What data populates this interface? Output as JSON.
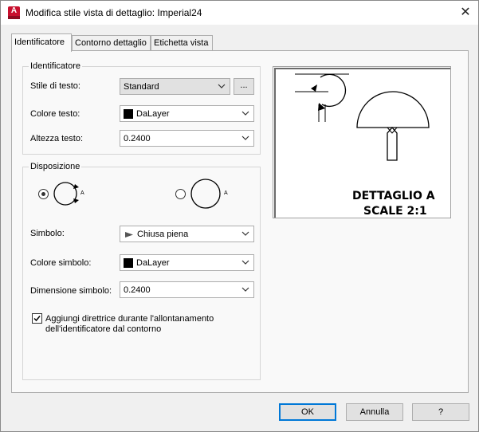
{
  "window": {
    "title": "Modifica stile vista di dettaglio: Imperial24",
    "app_icon_letter": "A",
    "close_glyph": "✕"
  },
  "tabs": [
    {
      "label": "Identificatore",
      "active": true
    },
    {
      "label": "Contorno dettaglio",
      "active": false
    },
    {
      "label": "Etichetta vista",
      "active": false
    }
  ],
  "identifier_group": {
    "title": "Identificatore",
    "text_style": {
      "label": "Stile di testo:",
      "value": "Standard",
      "browse_label": "..."
    },
    "text_color": {
      "label": "Colore testo:",
      "value": "DaLayer",
      "swatch_color": "#000000"
    },
    "text_height": {
      "label": "Altezza testo:",
      "value": "0.2400"
    }
  },
  "layout_group": {
    "title": "Disposizione",
    "option_a_letter": "A",
    "option_b_letter": "A",
    "symbol": {
      "label": "Simbolo:",
      "value": "Chiusa piena"
    },
    "symbol_color": {
      "label": "Colore simbolo:",
      "value": "DaLayer",
      "swatch_color": "#000000"
    },
    "symbol_size": {
      "label": "Dimensione simbolo:",
      "value": "0.2400"
    },
    "leader_checkbox": {
      "checked": true,
      "line1": "Aggiungi direttrice durante l'allontanamento",
      "line2": "dell'identificatore dal contorno"
    }
  },
  "preview": {
    "line1": "DETTAGLIO A",
    "line2": "SCALE 2:1"
  },
  "buttons": {
    "ok": "OK",
    "cancel": "Annulla",
    "help": "?"
  },
  "colors": {
    "accent": "#0078d7",
    "app_icon": "#c8102e"
  }
}
